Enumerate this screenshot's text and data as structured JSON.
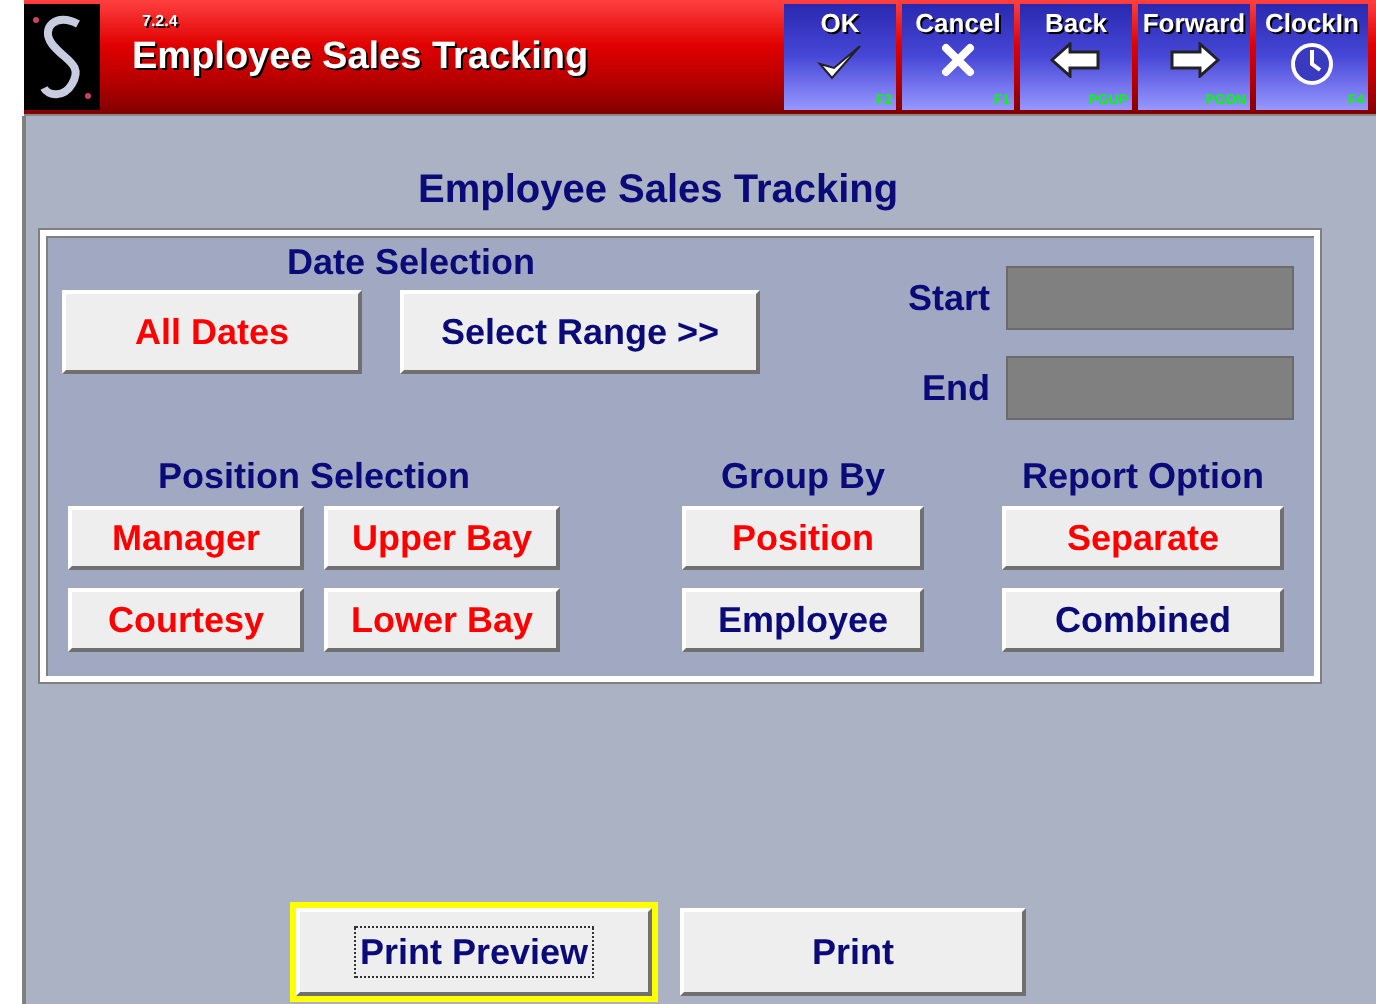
{
  "app": {
    "version": "7.2.4",
    "title": "Employee Sales Tracking"
  },
  "toolbar": [
    {
      "label": "OK",
      "kind": "check",
      "key": "F2"
    },
    {
      "label": "Cancel",
      "kind": "cross",
      "key": "F1"
    },
    {
      "label": "Back",
      "kind": "left",
      "key": "PGUP"
    },
    {
      "label": "Forward",
      "kind": "right",
      "key": "PGDN"
    },
    {
      "label": "ClockIn",
      "kind": "clock",
      "key": "F4"
    }
  ],
  "heading": "Employee Sales Tracking",
  "date_selection": {
    "label": "Date Selection",
    "options": [
      {
        "label": "All Dates",
        "selected": true
      },
      {
        "label": "Select Range >>",
        "selected": false
      }
    ],
    "start_label": "Start",
    "end_label": "End"
  },
  "position_selection": {
    "label": "Position Selection",
    "options": [
      {
        "label": "Manager",
        "selected": true
      },
      {
        "label": "Upper Bay",
        "selected": true
      },
      {
        "label": "Courtesy",
        "selected": true
      },
      {
        "label": "Lower Bay",
        "selected": true
      }
    ]
  },
  "group_by": {
    "label": "Group By",
    "options": [
      {
        "label": "Position",
        "selected": true
      },
      {
        "label": "Employee",
        "selected": false
      }
    ]
  },
  "report_option": {
    "label": "Report Option",
    "options": [
      {
        "label": "Separate",
        "selected": true
      },
      {
        "label": "Combined",
        "selected": false
      }
    ]
  },
  "buttons": [
    {
      "label": "Print Preview",
      "focused": true
    },
    {
      "label": "Print",
      "focused": false
    }
  ]
}
